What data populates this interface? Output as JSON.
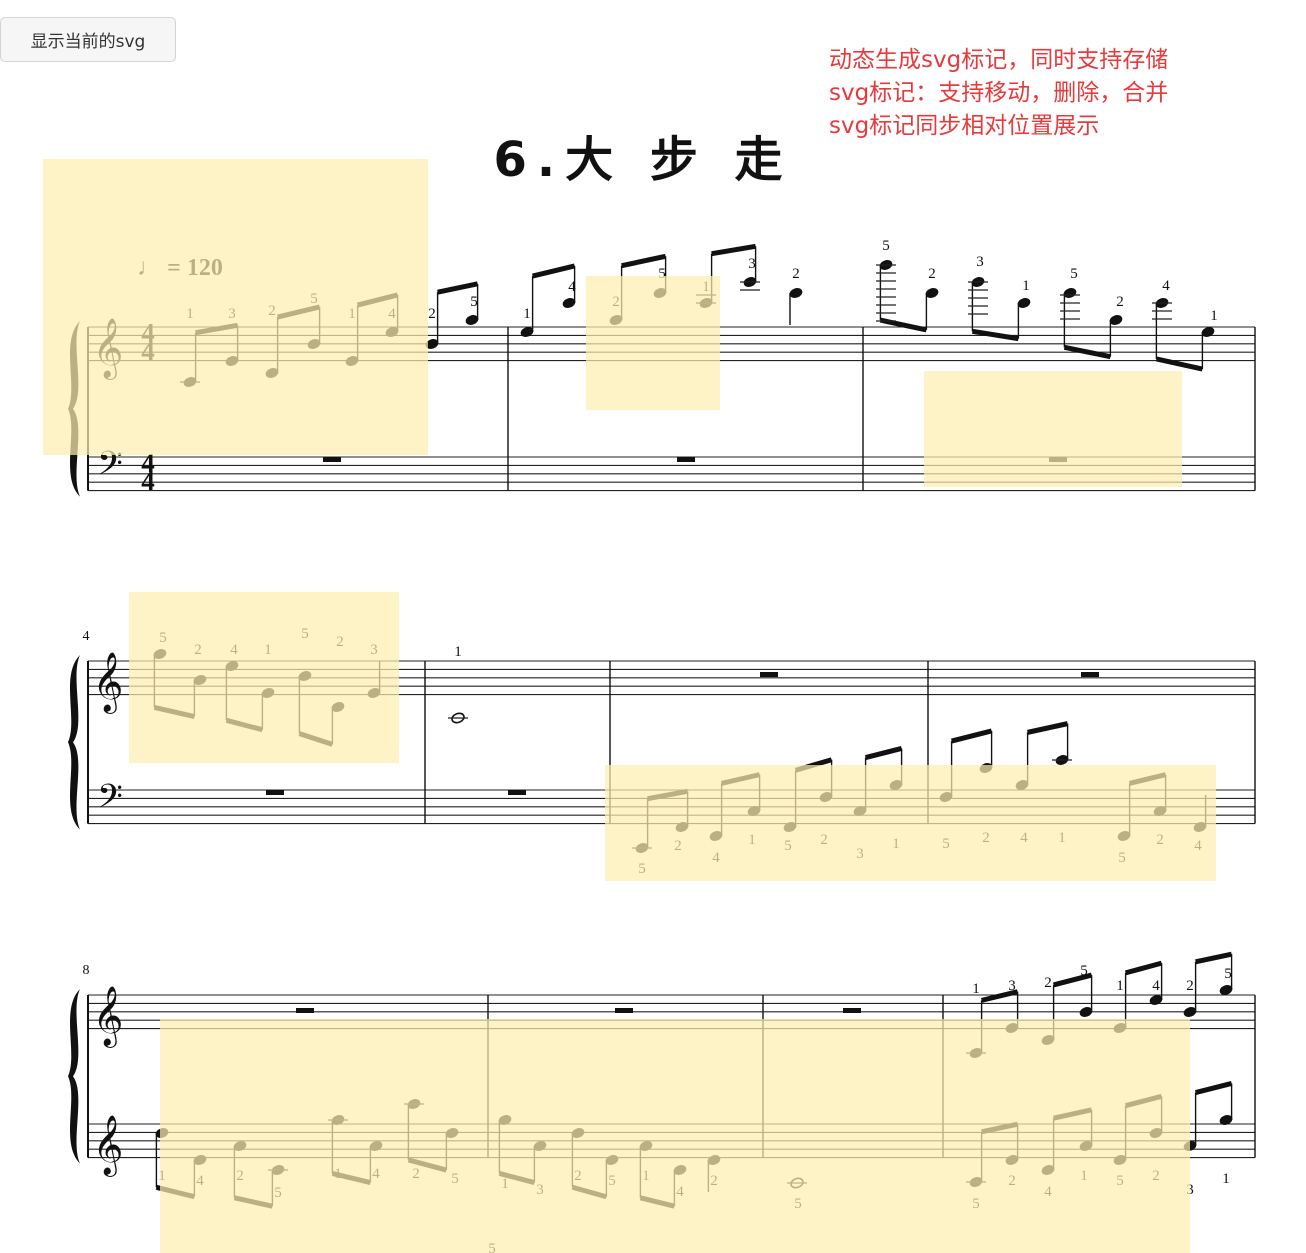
{
  "toolbar": {
    "show_svg_label": "显示当前的svg"
  },
  "note": {
    "line1": "动态生成svg标记，同时支持存储",
    "line2": "svg标记：支持移动，删除，合并",
    "line3": "svg标记同步相对位置展示"
  },
  "score": {
    "title": "6.大 步 走",
    "tempo": "♩ = 120",
    "time_signature": {
      "top": "4",
      "bottom": "4"
    },
    "measure_numbers": [
      "4",
      "8"
    ],
    "highlight_color": "#fdeeb0",
    "fingerings": {
      "system1": [
        "1",
        "3",
        "2",
        "5",
        "1",
        "4",
        "2",
        "5",
        "1",
        "4",
        "2",
        "5",
        "1",
        "3",
        "2",
        "5",
        "2",
        "3",
        "2",
        "4",
        "1"
      ],
      "system2_treble": [
        "5",
        "2",
        "4",
        "1",
        "5",
        "2",
        "3",
        "1"
      ],
      "system2_bass": [
        "5",
        "2",
        "4",
        "1",
        "5",
        "2",
        "3",
        "1",
        "5",
        "2",
        "4",
        "1",
        "5",
        "2",
        "4"
      ],
      "system3_treble": [
        "1",
        "3",
        "2",
        "5",
        "1",
        "4",
        "2",
        "5"
      ],
      "system3_bass": [
        "1",
        "4",
        "2",
        "5",
        "1",
        "4",
        "2",
        "5",
        "1",
        "3",
        "2",
        "5",
        "1",
        "4",
        "2",
        "5",
        "5",
        "2",
        "4",
        "1",
        "5",
        "2",
        "3",
        "1",
        "5"
      ]
    }
  }
}
